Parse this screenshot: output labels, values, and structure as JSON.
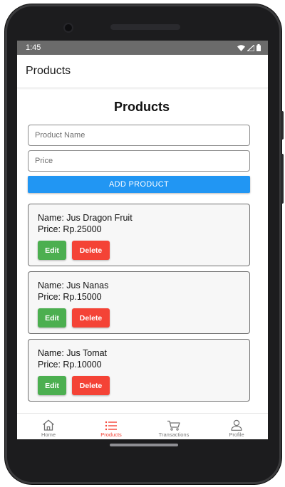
{
  "status_bar": {
    "time": "1:45",
    "icons": [
      "wifi-icon",
      "signal-icon",
      "battery-icon"
    ]
  },
  "app_bar": {
    "title": "Products"
  },
  "page": {
    "heading": "Products"
  },
  "form": {
    "name_placeholder": "Product Name",
    "name_value": "",
    "price_placeholder": "Price",
    "price_value": "",
    "add_label": "ADD PRODUCT"
  },
  "products": [
    {
      "name_line": "Name: Jus Dragon Fruit",
      "price_line": "Price: Rp.25000",
      "edit_label": "Edit",
      "delete_label": "Delete"
    },
    {
      "name_line": "Name: Jus Nanas",
      "price_line": "Price: Rp.15000",
      "edit_label": "Edit",
      "delete_label": "Delete"
    },
    {
      "name_line": "Name: Jus Tomat",
      "price_line": "Price: Rp.10000",
      "edit_label": "Edit",
      "delete_label": "Delete"
    }
  ],
  "bottom_nav": {
    "active": "Products",
    "items": [
      {
        "label": "Home",
        "icon": "home-icon"
      },
      {
        "label": "Products",
        "icon": "list-icon"
      },
      {
        "label": "Transactions",
        "icon": "cart-icon"
      },
      {
        "label": "Profile",
        "icon": "person-icon"
      }
    ]
  },
  "colors": {
    "primary": "#2196f3",
    "edit": "#4caf50",
    "delete": "#f44336",
    "nav_active": "#f44336",
    "status_bar": "#6b6b6b"
  }
}
